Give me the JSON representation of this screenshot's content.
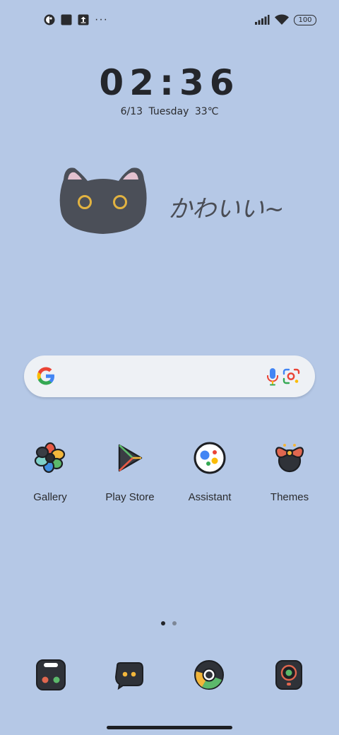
{
  "status_bar": {
    "left_icons": [
      "app-notification-icon",
      "square-notification-icon",
      "upload-notification-icon"
    ],
    "more_dots": "···",
    "battery": "100"
  },
  "clock": {
    "time": "02:36",
    "date": "6/13  Tuesday  33℃"
  },
  "widget": {
    "text": "かわいい~"
  },
  "search": {
    "icons": [
      "google-logo-icon",
      "microphone-icon",
      "lens-camera-icon"
    ]
  },
  "apps": [
    {
      "label": "Gallery",
      "icon": "gallery-flower-icon"
    },
    {
      "label": "Play Store",
      "icon": "play-store-icon"
    },
    {
      "label": "Assistant",
      "icon": "assistant-icon"
    },
    {
      "label": "Themes",
      "icon": "themes-bow-icon"
    }
  ],
  "page_indicator": {
    "count": 2,
    "active": 1
  },
  "dock": [
    {
      "icon": "phone-dialer-icon"
    },
    {
      "icon": "messages-bubble-icon"
    },
    {
      "icon": "chrome-icon"
    },
    {
      "icon": "camera-icon"
    }
  ]
}
